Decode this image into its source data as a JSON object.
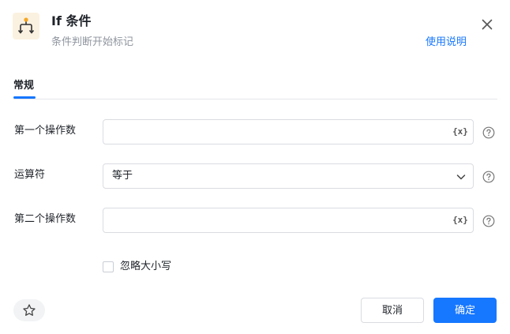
{
  "header": {
    "title": "If 条件",
    "subtitle": "条件判断开始标记",
    "help_link": "使用说明",
    "app_icon": "branch-icon",
    "close_icon": "close-icon"
  },
  "tabs": [
    {
      "label": "常规",
      "active": true
    }
  ],
  "form": {
    "first_operand": {
      "label": "第一个操作数",
      "value": "",
      "icon": "variable-icon",
      "icon_text": "{x}"
    },
    "operator": {
      "label": "运算符",
      "value": "等于",
      "icon": "chevron-down-icon"
    },
    "second_operand": {
      "label": "第二个操作数",
      "value": "",
      "icon": "variable-icon",
      "icon_text": "{x}"
    },
    "ignore_case": {
      "label": "忽略大小写",
      "checked": false
    }
  },
  "footer": {
    "favorite_icon": "star-icon",
    "cancel_label": "取消",
    "ok_label": "确定"
  },
  "colors": {
    "accent": "#1677ff",
    "icon_bg": "#fbf1e0",
    "icon_accent": "#f5a623"
  }
}
